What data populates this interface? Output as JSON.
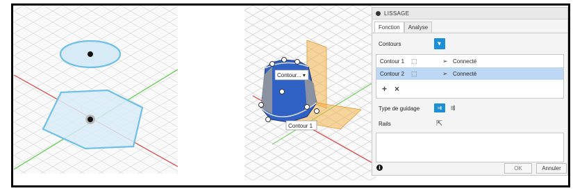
{
  "dialog": {
    "title": "LISSAGE",
    "tabs": [
      {
        "label": "Fonction",
        "active": true
      },
      {
        "label": "Analyse",
        "active": false
      }
    ],
    "contours_label": "Contours",
    "contours": [
      {
        "name": "Contour 1",
        "status": "Connecté",
        "selected": false
      },
      {
        "name": "Contour 2",
        "status": "Connecté",
        "selected": true
      }
    ],
    "add_symbol": "+",
    "remove_symbol": "×",
    "guide_type_label": "Type de guidage",
    "rails_label": "Rails",
    "ok_label": "OK",
    "cancel_label": "Annuler",
    "info_symbol": "i"
  },
  "viewport": {
    "dropdown_label": "Contour... ▾",
    "tooltip_label": "Contour 1"
  },
  "colors": {
    "accent_blue": "#1d8fd8",
    "selection_blue": "#bcd8f4",
    "sketch_blue": "#6fbfe6",
    "body_blue": "#2f62c4",
    "plane_orange": "#f2b24a",
    "axis_red": "#e04040",
    "axis_green": "#5ec94a"
  },
  "icons": {
    "panel_title": "collapse-dot-icon",
    "select": "cursor-arrow-icon",
    "profile": "profile-icon",
    "connected": "connected-arrow-icon",
    "guide_rails": "rails-guide-icon",
    "guide_centerline": "centerline-guide-icon",
    "rails_cursor": "cursor-arrow-icon",
    "info": "info-icon"
  }
}
